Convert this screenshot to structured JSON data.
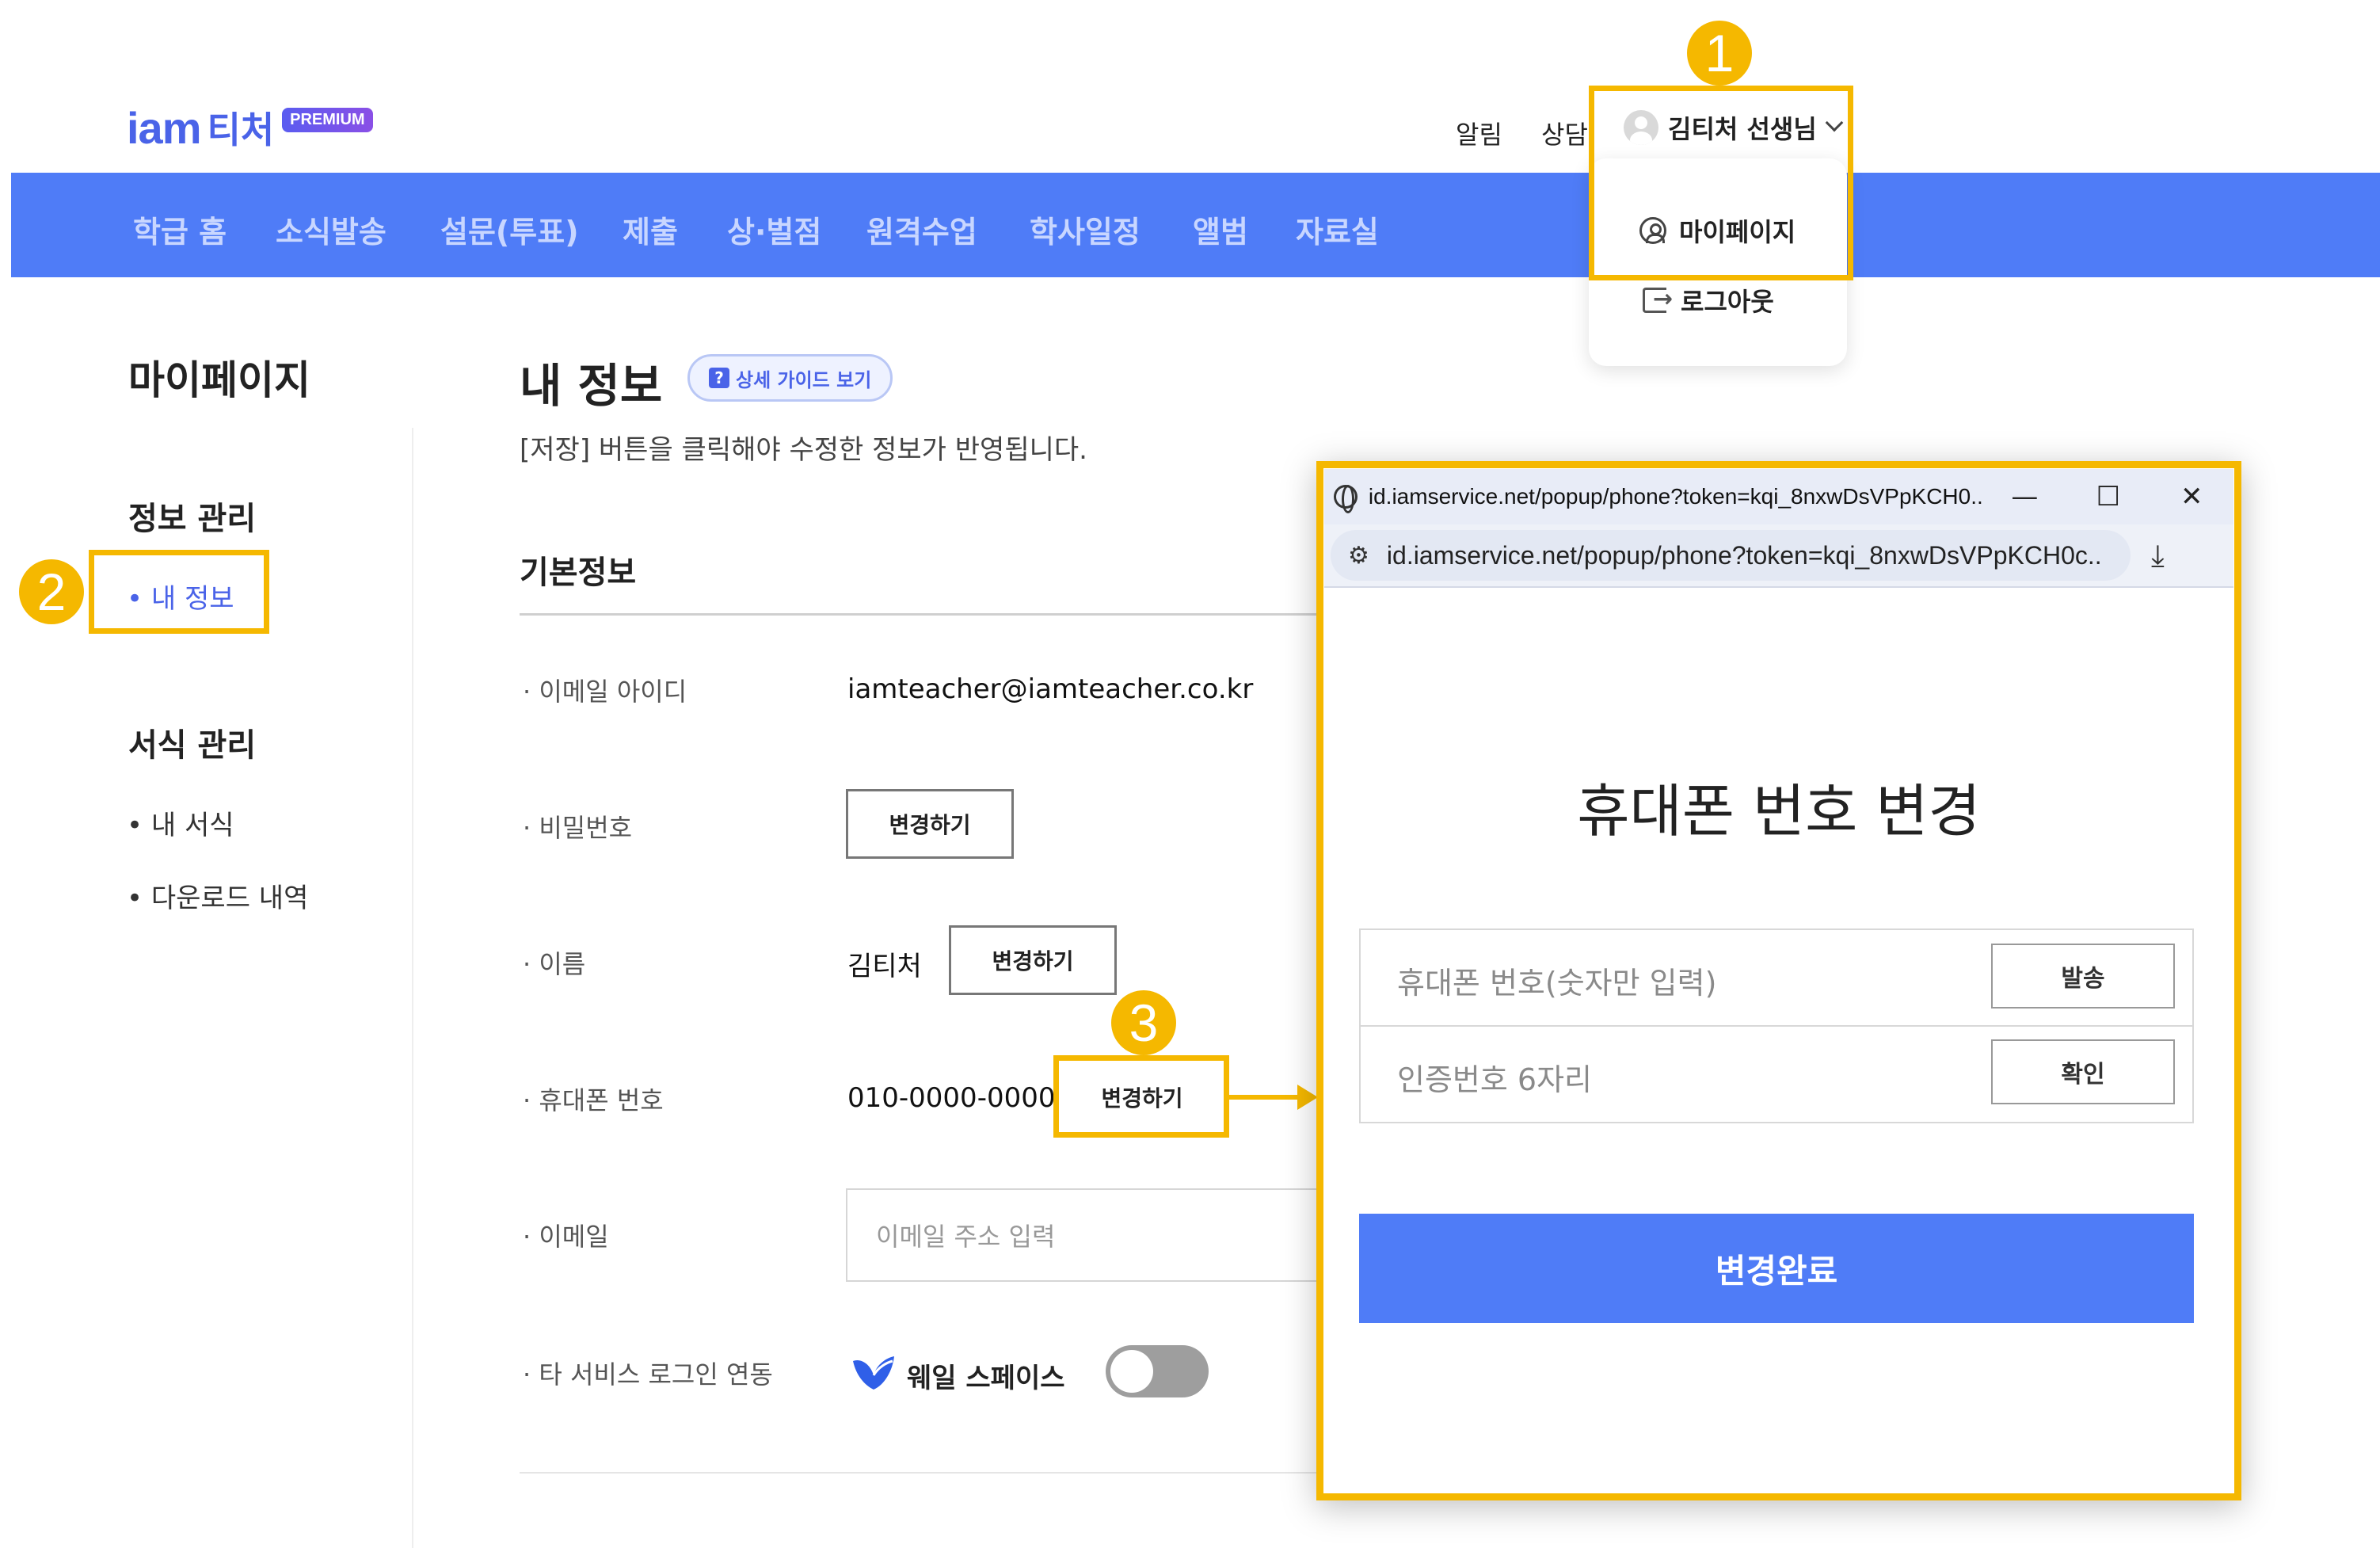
{
  "header": {
    "logo_main": "iam",
    "logo_suffix": "티처",
    "logo_badge": "PREMIUM",
    "links": [
      "알림",
      "상담"
    ],
    "user_name": "김티처 선생님"
  },
  "nav": {
    "items": [
      "학급 홈",
      "소식발송",
      "설문(투표)",
      "제출",
      "상·벌점",
      "원격수업",
      "학사일정",
      "앨범",
      "자료실"
    ]
  },
  "dropdown": {
    "mypage_label": "마이페이지",
    "logout_label": "로그아웃"
  },
  "callouts": [
    "1",
    "2",
    "3"
  ],
  "sidebar": {
    "title": "마이페이지",
    "sections": [
      {
        "title": "정보 관리",
        "items": [
          "• 내 정보"
        ]
      },
      {
        "title": "서식 관리",
        "items": [
          "• 내 서식",
          "• 다운로드 내역"
        ]
      }
    ]
  },
  "main": {
    "title": "내 정보",
    "guide_chip": "상세 가이드 보기",
    "guide_icon_text": "?",
    "notice": "[저장] 버튼을 클릭해야 수정한 정보가 반영됩니다.",
    "section_title": "기본정보",
    "fields": {
      "email_id_label": "· 이메일 아이디",
      "email_id_value": "iamteacher@iamteacher.co.kr",
      "password_label": "· 비밀번호",
      "password_button": "변경하기",
      "name_label": "· 이름",
      "name_value": "김티처",
      "name_button": "변경하기",
      "phone_label": "· 휴대폰 번호",
      "phone_value": "010-0000-0000",
      "phone_button": "변경하기",
      "email_label": "· 이메일",
      "email_placeholder": "이메일 주소 입력",
      "link_label": "· 타 서비스 로그인 연동",
      "whale_label": "웨일 스페이스",
      "whale_toggle_on": false
    }
  },
  "popup": {
    "titlebar_url": "id.iamservice.net/popup/phone?token=kqi_8nxwDsVPpKCH0...",
    "address_url": "id.iamservice.net/popup/phone?token=kqi_8nxwDsVPpKCH0c...",
    "minimize_glyph": "—",
    "maximize_glyph": "☐",
    "close_glyph": "✕",
    "heading": "휴대폰 번호 변경",
    "phone_placeholder": "휴대폰 번호(숫자만 입력)",
    "send_button": "발송",
    "code_placeholder": "인증번호 6자리",
    "confirm_button": "확인",
    "submit_button": "변경완료"
  },
  "colors": {
    "brand": "#4f7cf7",
    "highlight": "#f5b800",
    "whale": "#2f5fe8"
  },
  "icons": [
    "user-avatar-icon",
    "chevron-down-icon",
    "user-circle-icon",
    "logout-icon",
    "question-icon",
    "whale-icon",
    "globe-icon",
    "site-settings-icon",
    "download-icon"
  ]
}
